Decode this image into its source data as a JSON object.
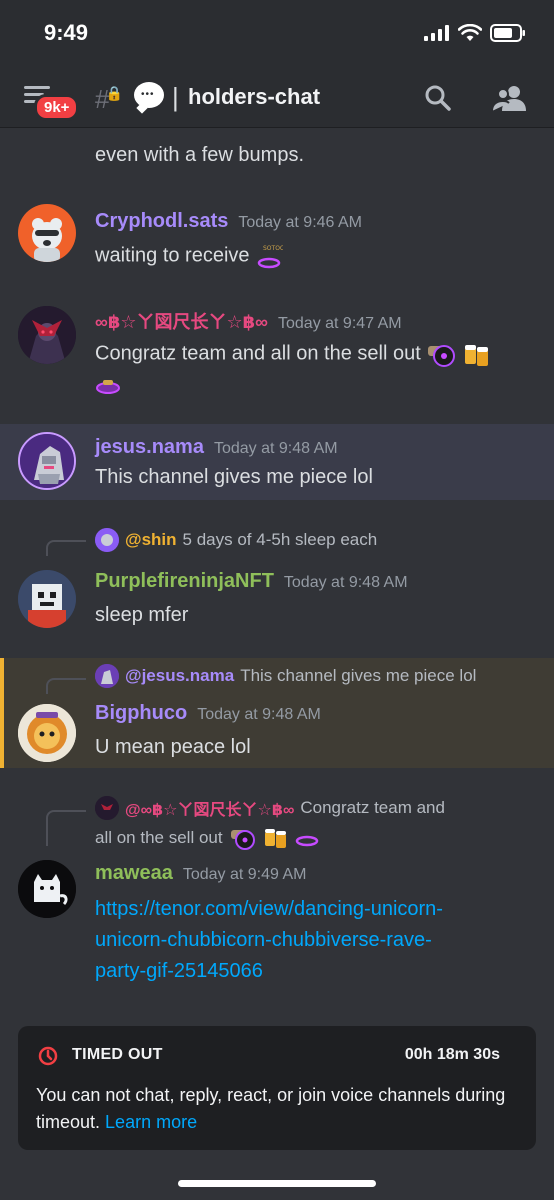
{
  "status_bar": {
    "time": "9:49"
  },
  "header": {
    "badge": "9k+",
    "channel_name": "holders-chat",
    "separator": "|"
  },
  "messages": [
    {
      "type": "continuation",
      "text": "even with a few bumps."
    },
    {
      "username": "Cryphodl.sats",
      "username_color": "#a78bfa",
      "timestamp": "Today at 9:46 AM",
      "text": "waiting to receive"
    },
    {
      "username": "∞฿☆ㄚ図尺长ㄚ☆฿∞",
      "username_color": "#e64980",
      "timestamp": "Today at 9:47 AM",
      "text": "Congratz team and all on the sell out"
    },
    {
      "username": "jesus.nama",
      "username_color": "#a78bfa",
      "timestamp": "Today at 9:48 AM",
      "text": "This channel gives me piece lol"
    },
    {
      "reply_to": "@shin",
      "reply_to_color": "#f0b232",
      "reply_text": "5 days of 4-5h sleep each",
      "username": "PurplefireninjaNFT",
      "username_color": "#8fbf5a",
      "timestamp": "Today at 9:48 AM",
      "text": "sleep mfer"
    },
    {
      "reply_to": "@jesus.nama",
      "reply_to_color": "#a78bfa",
      "reply_text": "This channel gives me piece lol",
      "username": "Bigphuco",
      "username_color": "#a78bfa",
      "timestamp": "Today at 9:48 AM",
      "text": "U mean peace lol"
    },
    {
      "reply_to": "@∞฿☆ㄚ図尺长ㄚ☆฿∞",
      "reply_to_color": "#e64980",
      "reply_text": "Congratz team and",
      "reply_text_2": "all on the sell out",
      "username": "maweaa",
      "username_color": "#8fbf5a",
      "timestamp": "Today at 9:49 AM",
      "link_lines": [
        "https://tenor.com/view/dancing-unicorn-",
        "unicorn-chubbicorn-chubbiverse-rave-",
        "party-gif-25145066"
      ]
    }
  ],
  "timeout": {
    "title": "TIMED OUT",
    "timer": "00h 18m 30s",
    "text": "You can not chat, reply, react, or join voice channels during timeout.",
    "link": "Learn more"
  }
}
